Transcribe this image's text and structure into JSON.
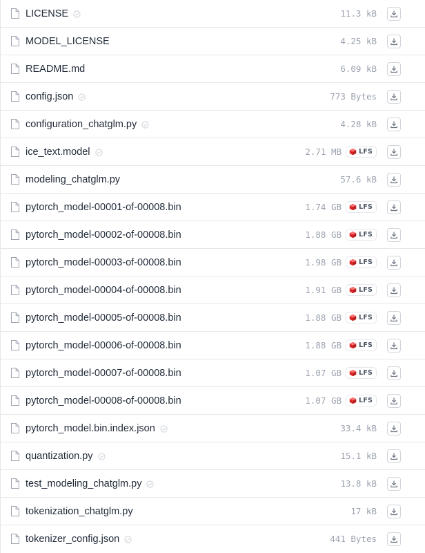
{
  "files": [
    {
      "name": "LICENSE",
      "size": "11.3 kB",
      "safe": true,
      "lfs": false,
      "icon": "file-icon"
    },
    {
      "name": "MODEL_LICENSE",
      "size": "4.25 kB",
      "safe": false,
      "lfs": false,
      "icon": "file-icon"
    },
    {
      "name": "README.md",
      "size": "6.09 kB",
      "safe": false,
      "lfs": false,
      "icon": "file-icon"
    },
    {
      "name": "config.json",
      "size": "773 Bytes",
      "safe": true,
      "lfs": false,
      "icon": "file-icon"
    },
    {
      "name": "configuration_chatglm.py",
      "size": "4.28 kB",
      "safe": true,
      "lfs": false,
      "icon": "file-icon"
    },
    {
      "name": "ice_text.model",
      "size": "2.71 MB",
      "safe": true,
      "lfs": true,
      "icon": "file-icon"
    },
    {
      "name": "modeling_chatglm.py",
      "size": "57.6 kB",
      "safe": false,
      "lfs": false,
      "icon": "file-icon"
    },
    {
      "name": "pytorch_model-00001-of-00008.bin",
      "size": "1.74 GB",
      "safe": false,
      "lfs": true,
      "icon": "file-icon"
    },
    {
      "name": "pytorch_model-00002-of-00008.bin",
      "size": "1.88 GB",
      "safe": false,
      "lfs": true,
      "icon": "file-icon"
    },
    {
      "name": "pytorch_model-00003-of-00008.bin",
      "size": "1.98 GB",
      "safe": false,
      "lfs": true,
      "icon": "file-icon"
    },
    {
      "name": "pytorch_model-00004-of-00008.bin",
      "size": "1.91 GB",
      "safe": false,
      "lfs": true,
      "icon": "file-icon"
    },
    {
      "name": "pytorch_model-00005-of-00008.bin",
      "size": "1.88 GB",
      "safe": false,
      "lfs": true,
      "icon": "file-icon"
    },
    {
      "name": "pytorch_model-00006-of-00008.bin",
      "size": "1.88 GB",
      "safe": false,
      "lfs": true,
      "icon": "file-icon"
    },
    {
      "name": "pytorch_model-00007-of-00008.bin",
      "size": "1.07 GB",
      "safe": false,
      "lfs": true,
      "icon": "file-icon"
    },
    {
      "name": "pytorch_model-00008-of-00008.bin",
      "size": "1.07 GB",
      "safe": false,
      "lfs": true,
      "icon": "file-icon"
    },
    {
      "name": "pytorch_model.bin.index.json",
      "size": "33.4 kB",
      "safe": true,
      "lfs": false,
      "icon": "file-icon"
    },
    {
      "name": "quantization.py",
      "size": "15.1 kB",
      "safe": true,
      "lfs": false,
      "icon": "file-icon"
    },
    {
      "name": "test_modeling_chatglm.py",
      "size": "13.8 kB",
      "safe": true,
      "lfs": false,
      "icon": "file-icon"
    },
    {
      "name": "tokenization_chatglm.py",
      "size": "17 kB",
      "safe": false,
      "lfs": false,
      "icon": "file-icon"
    },
    {
      "name": "tokenizer_config.json",
      "size": "441 Bytes",
      "safe": true,
      "lfs": false,
      "icon": "file-icon"
    }
  ],
  "lfs_label": "LFS",
  "colors": {
    "text": "#1f2937",
    "muted": "#9ca3af",
    "border": "#e5e7eb",
    "lfs_red": "#dc2626"
  }
}
